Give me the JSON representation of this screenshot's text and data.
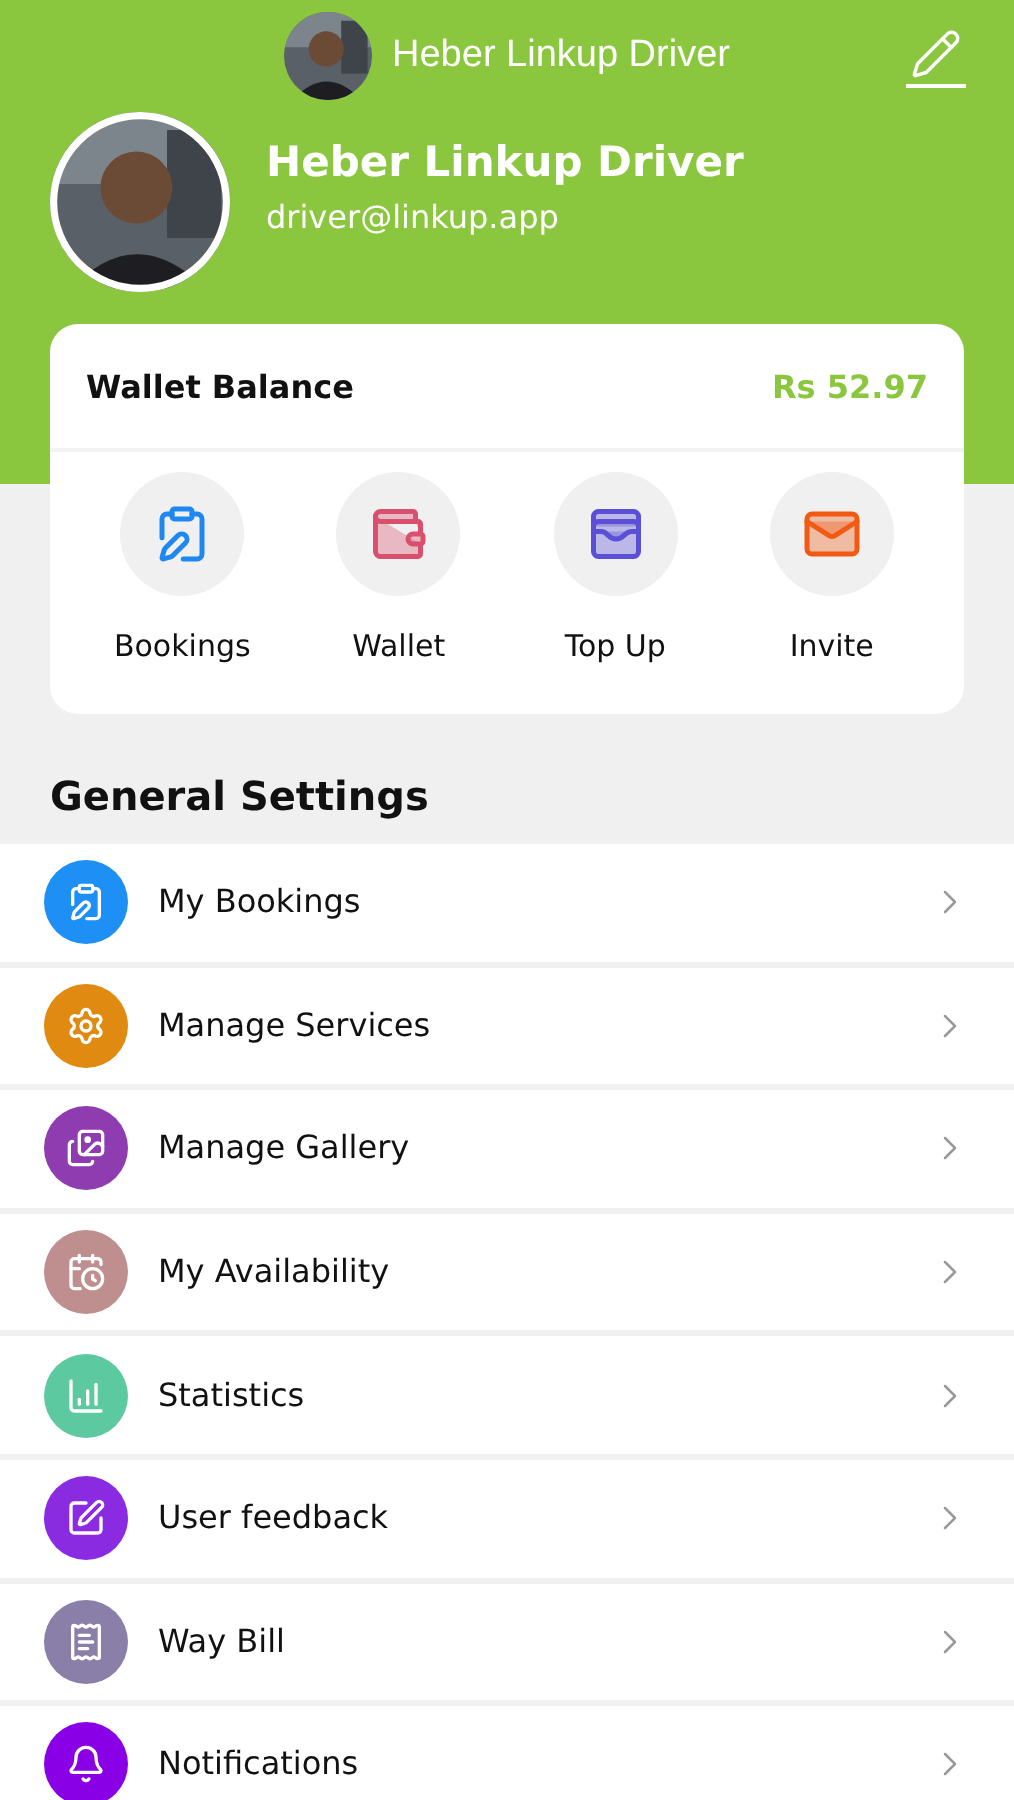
{
  "top_bar": {
    "title": "Heber Linkup Driver"
  },
  "profile": {
    "name": "Heber Linkup Driver",
    "email": "driver@linkup.app"
  },
  "wallet": {
    "label": "Wallet Balance",
    "amount": "Rs 52.97"
  },
  "quick_actions": [
    {
      "kind": "bookings",
      "label": "Bookings",
      "color": "#1e88f0"
    },
    {
      "kind": "wallet",
      "label": "Wallet",
      "color": "#d9506f"
    },
    {
      "kind": "topup",
      "label": "Top Up",
      "color": "#5a4fd6"
    },
    {
      "kind": "invite",
      "label": "Invite",
      "color": "#f25a14"
    }
  ],
  "section_title": "General Settings",
  "menu": [
    {
      "kind": "bookings",
      "label": "My Bookings",
      "color": "#1e8ff5"
    },
    {
      "kind": "services",
      "label": "Manage Services",
      "color": "#e08a12"
    },
    {
      "kind": "gallery",
      "label": "Manage Gallery",
      "color": "#8e3cb0"
    },
    {
      "kind": "availability",
      "label": "My Availability",
      "color": "#bf8e8e"
    },
    {
      "kind": "statistics",
      "label": "Statistics",
      "color": "#5cc9a0"
    },
    {
      "kind": "feedback",
      "label": "User feedback",
      "color": "#8a2be2"
    },
    {
      "kind": "waybill",
      "label": "Way Bill",
      "color": "#8a7fa8"
    },
    {
      "kind": "notifications",
      "label": "Notifications",
      "color": "#8a00e6"
    }
  ]
}
